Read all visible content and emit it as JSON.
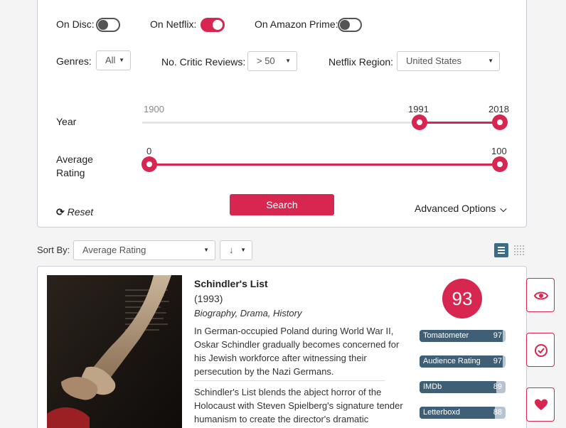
{
  "filters": {
    "toggles": [
      {
        "label": "On Disc:",
        "state": "off"
      },
      {
        "label": "On Netflix:",
        "state": "on"
      },
      {
        "label": "On Amazon Prime:",
        "state": "off"
      }
    ],
    "genres": {
      "label": "Genres:",
      "value": "All"
    },
    "critic_reviews": {
      "label": "No. Critic Reviews:",
      "value": "> 50"
    },
    "region": {
      "label": "Netflix Region:",
      "value": "United States"
    },
    "year": {
      "label": "Year",
      "min_label": "1900",
      "low": "1991",
      "high": "2018"
    },
    "rating": {
      "label_line1": "Average",
      "label_line2": "Rating",
      "low": "0",
      "high": "100"
    },
    "reset_label": "Reset",
    "search_label": "Search",
    "advanced_label": "Advanced Options"
  },
  "sort": {
    "label": "Sort By:",
    "field": "Average Rating",
    "direction": "↓"
  },
  "movie": {
    "title": "Schindler's List",
    "year": "(1993)",
    "genres": "Biography, Drama, History",
    "synopsis": "In German-occupied Poland during World War II, Oskar Schindler gradually becomes concerned for his Jewish workforce after witnessing their persecution by the Nazi Germans.",
    "review": "Schindler's List blends the abject horror of the Holocaust with Steven Spielberg's signature tender humanism to create the director's dramatic",
    "score": "93",
    "ratings": [
      {
        "name": "Tomatometer",
        "value": "97",
        "fraction": 0.97
      },
      {
        "name": "Audience Rating",
        "value": "97",
        "fraction": 0.97
      },
      {
        "name": "IMDb",
        "value": "89",
        "fraction": 0.89
      },
      {
        "name": "Letterboxd",
        "value": "88",
        "fraction": 0.88
      }
    ]
  },
  "side_actions": [
    {
      "icon": "eye-icon"
    },
    {
      "icon": "check-circle-icon"
    },
    {
      "icon": "heart-icon"
    }
  ],
  "colors": {
    "accent": "#d7264f",
    "bar_fill": "#3e5f76",
    "bar_track": "#b6c3d0",
    "view_active": "#3c6b8a"
  }
}
